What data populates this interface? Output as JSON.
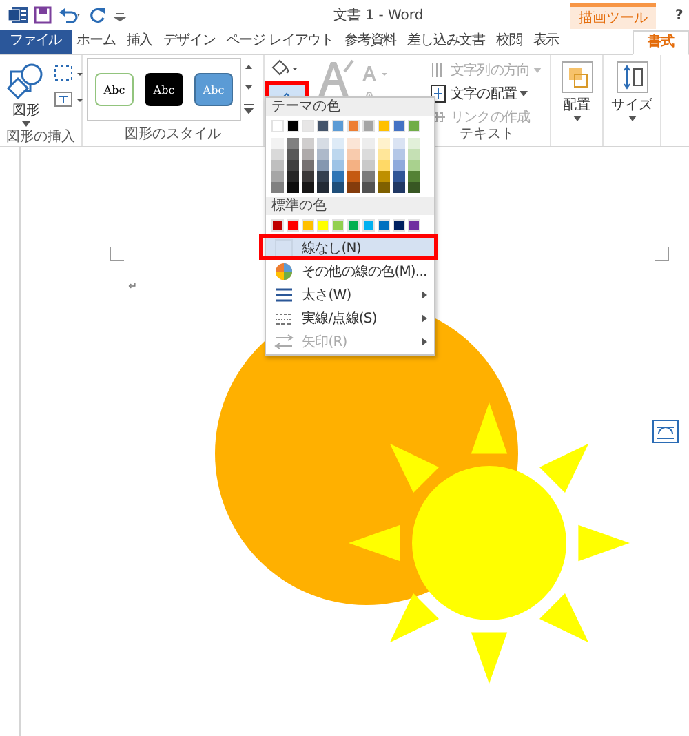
{
  "window": {
    "title": "文書 1 - Word",
    "context_tab": "描画ツール",
    "help": "?"
  },
  "tabs": [
    {
      "label": "ファイル",
      "kind": "file",
      "selected": false
    },
    {
      "label": "ホーム",
      "kind": "tab",
      "selected": false
    },
    {
      "label": "挿入",
      "kind": "tab",
      "selected": false
    },
    {
      "label": "デザイン",
      "kind": "tab",
      "selected": false
    },
    {
      "label": "ページ レイアウト",
      "kind": "tab",
      "selected": false
    },
    {
      "label": "参考資料",
      "kind": "tab",
      "selected": false
    },
    {
      "label": "差し込み文書",
      "kind": "tab",
      "selected": false
    },
    {
      "label": "校閲",
      "kind": "tab",
      "selected": false
    },
    {
      "label": "表示",
      "kind": "tab",
      "selected": false
    },
    {
      "label": "書式",
      "kind": "context",
      "selected": true
    }
  ],
  "ribbon": {
    "insert_group": {
      "shapes_button": "図形",
      "label": "図形の挿入"
    },
    "style_group": {
      "label": "図形のスタイル",
      "styles": [
        {
          "text": "Abc",
          "kind": "outline"
        },
        {
          "text": "Abc",
          "kind": "dark"
        },
        {
          "text": "Abc",
          "kind": "blue"
        }
      ],
      "outline_button_highlighted": true
    },
    "text_group": {
      "label": "テキスト",
      "items": [
        {
          "label": "文字列の方向",
          "disabled": true
        },
        {
          "label": "文字の配置",
          "disabled": false
        },
        {
          "label": "リンクの作成",
          "disabled": true
        }
      ]
    },
    "arrange_button": "配置",
    "size_button": "サイズ"
  },
  "outline_menu": {
    "theme_header": "テーマの色",
    "theme_colors": [
      {
        "color": "#ffffff",
        "shades": [
          {
            "color": "#f2f2f2"
          },
          {
            "color": "#d9d9d9"
          },
          {
            "color": "#bfbfbf"
          },
          {
            "color": "#a6a6a6"
          },
          {
            "color": "#808080"
          }
        ]
      },
      {
        "color": "#000000",
        "shades": [
          {
            "color": "#808080"
          },
          {
            "color": "#595959"
          },
          {
            "color": "#404040"
          },
          {
            "color": "#262626"
          },
          {
            "color": "#0d0d0d"
          }
        ]
      },
      {
        "color": "#e7e6e6",
        "shades": [
          {
            "color": "#d0cece"
          },
          {
            "color": "#aeaaaa"
          },
          {
            "color": "#767171"
          },
          {
            "color": "#3b3838"
          },
          {
            "color": "#171616"
          }
        ]
      },
      {
        "color": "#44546a",
        "shades": [
          {
            "color": "#d6dce4"
          },
          {
            "color": "#adb9ca"
          },
          {
            "color": "#8497b0"
          },
          {
            "color": "#333f4f"
          },
          {
            "color": "#222a35"
          }
        ]
      },
      {
        "color": "#5b9bd5",
        "shades": [
          {
            "color": "#deebf7"
          },
          {
            "color": "#bdd7ee"
          },
          {
            "color": "#9dc3e6"
          },
          {
            "color": "#2e75b6"
          },
          {
            "color": "#1f4e79"
          }
        ]
      },
      {
        "color": "#ed7d31",
        "shades": [
          {
            "color": "#fbe5d6"
          },
          {
            "color": "#f8cbad"
          },
          {
            "color": "#f4b183"
          },
          {
            "color": "#c55a11"
          },
          {
            "color": "#843c0c"
          }
        ]
      },
      {
        "color": "#a5a5a5",
        "shades": [
          {
            "color": "#ededed"
          },
          {
            "color": "#dbdbdb"
          },
          {
            "color": "#c9c9c9"
          },
          {
            "color": "#7b7b7b"
          },
          {
            "color": "#525252"
          }
        ]
      },
      {
        "color": "#ffc000",
        "shades": [
          {
            "color": "#fff2cc"
          },
          {
            "color": "#ffe699"
          },
          {
            "color": "#ffd966"
          },
          {
            "color": "#bf9000"
          },
          {
            "color": "#7f6000"
          }
        ]
      },
      {
        "color": "#4472c4",
        "shades": [
          {
            "color": "#dae3f3"
          },
          {
            "color": "#b4c7e7"
          },
          {
            "color": "#8faadc"
          },
          {
            "color": "#2f5597"
          },
          {
            "color": "#203864"
          }
        ]
      },
      {
        "color": "#70ad47",
        "shades": [
          {
            "color": "#e2f0d9"
          },
          {
            "color": "#c5e0b4"
          },
          {
            "color": "#a9d18e"
          },
          {
            "color": "#548235"
          },
          {
            "color": "#385723"
          }
        ]
      }
    ],
    "standard_header": "標準の色",
    "standard_colors": [
      {
        "color": "#c00000"
      },
      {
        "color": "#ff0000"
      },
      {
        "color": "#ffc000"
      },
      {
        "color": "#ffff00"
      },
      {
        "color": "#92d050"
      },
      {
        "color": "#00b050"
      },
      {
        "color": "#00b0f0"
      },
      {
        "color": "#0070c0"
      },
      {
        "color": "#002060"
      },
      {
        "color": "#7030a0"
      }
    ],
    "items": [
      {
        "label": "線なし(N)",
        "kind": "none",
        "selected": true,
        "highlighted": true,
        "disabled": false
      },
      {
        "label": "その他の線の色(M)...",
        "kind": "more",
        "selected": false,
        "highlighted": false,
        "disabled": false
      },
      {
        "label": "太さ(W)",
        "kind": "weight",
        "selected": false,
        "highlighted": false,
        "disabled": false
      },
      {
        "label": "実線/点線(S)",
        "kind": "dash",
        "selected": false,
        "highlighted": false,
        "disabled": false
      },
      {
        "label": "矢印(R)",
        "kind": "arrow",
        "selected": false,
        "highlighted": false,
        "disabled": true
      }
    ]
  },
  "document": {
    "paragraph_mark": "↵"
  }
}
